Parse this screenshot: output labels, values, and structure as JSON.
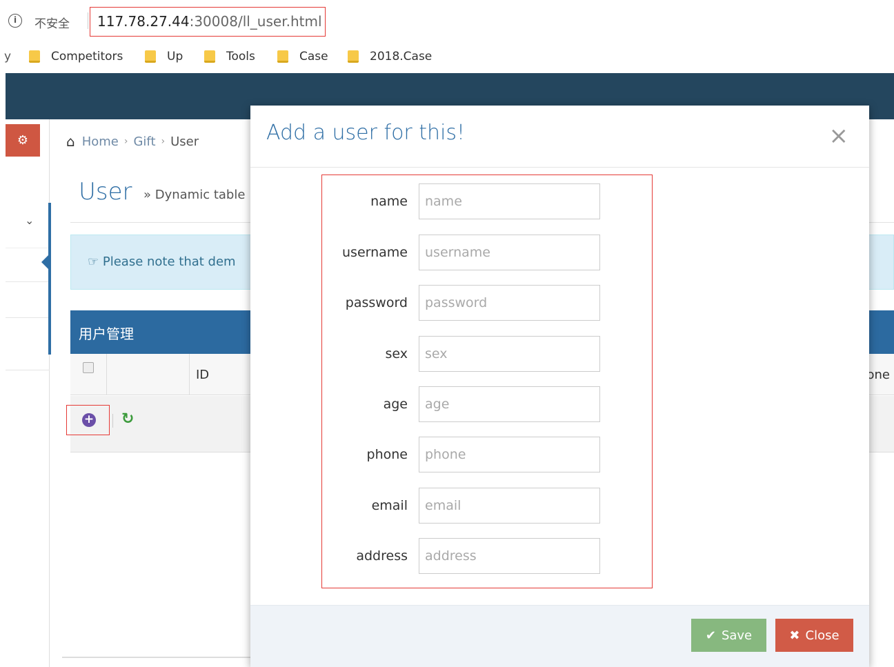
{
  "browser": {
    "info_icon": "i",
    "insecure_label": "不安全",
    "url_host": "117.78.27.44",
    "url_rest": ":30008/ll_user.html",
    "bookmark_leftover": "y",
    "bookmarks": [
      "Competitors",
      "Up",
      "Tools",
      "Case",
      "2018.Case"
    ]
  },
  "app": {
    "shortcut_icon": "⚙",
    "breadcrumb": {
      "home": "Home",
      "gift": "Gift",
      "user": "User",
      "sep": "›"
    },
    "page_title": "User",
    "page_subtitle": "» Dynamic table",
    "note_text": "☞ Please note that dem",
    "widget_title": "用户管理",
    "table": {
      "col_id": "ID",
      "col_phone_fragment": "one"
    },
    "toolbar": {
      "add_icon": "+",
      "refresh_icon": "↻"
    }
  },
  "modal": {
    "title": "Add a user for this!",
    "close_icon": "×",
    "fields": [
      {
        "label": "name",
        "placeholder": "name"
      },
      {
        "label": "username",
        "placeholder": "username"
      },
      {
        "label": "password",
        "placeholder": "password"
      },
      {
        "label": "sex",
        "placeholder": "sex"
      },
      {
        "label": "age",
        "placeholder": "age"
      },
      {
        "label": "phone",
        "placeholder": "phone"
      },
      {
        "label": "email",
        "placeholder": "email"
      },
      {
        "label": "address",
        "placeholder": "address"
      }
    ],
    "save_label": "Save",
    "save_icon": "✔",
    "close_label": "Close",
    "close_button_icon": "✖"
  },
  "colors": {
    "navbar": "#24465e",
    "primary_blue": "#2e6ea5",
    "save_green": "#87b87f",
    "close_red": "#d15b47",
    "highlight_red": "#e53935"
  }
}
